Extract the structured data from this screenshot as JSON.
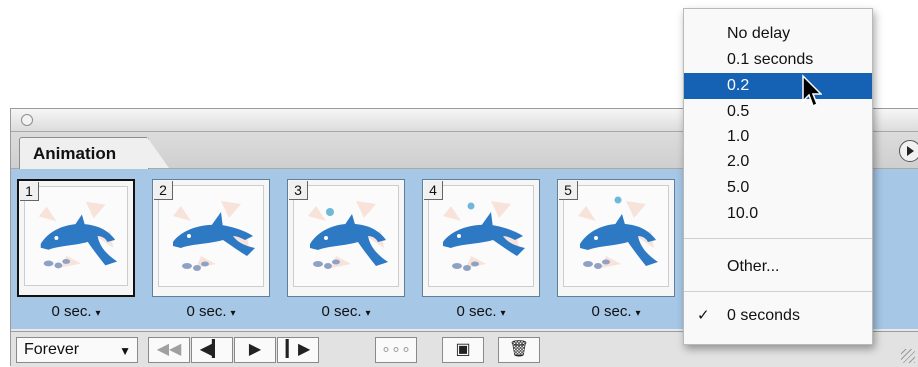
{
  "panel": {
    "tab_label": "Animation",
    "frames": [
      {
        "number": "1",
        "delay": "0 sec.",
        "selected": true
      },
      {
        "number": "2",
        "delay": "0 sec.",
        "selected": false
      },
      {
        "number": "3",
        "delay": "0 sec.",
        "selected": false
      },
      {
        "number": "4",
        "delay": "0 sec.",
        "selected": false
      },
      {
        "number": "5",
        "delay": "0 sec.",
        "selected": false
      }
    ],
    "delay_arrow": "▾",
    "loop_label": "Forever",
    "loop_arrow": "▼"
  },
  "toolbar": {
    "first_frame": "◀◀",
    "prev_frame": "◀▎",
    "play": "▶",
    "next_frame": "▎▶",
    "tween": "∘∘∘",
    "new_frame": "▣",
    "delete": "🗑"
  },
  "delay_menu": {
    "items": [
      "No delay",
      "0.1 seconds",
      "0.2",
      "0.5",
      "1.0",
      "2.0",
      "5.0",
      "10.0"
    ],
    "highlighted": "0.2",
    "other": "Other...",
    "current_check": "✓",
    "current_value": "0 seconds"
  },
  "colors": {
    "frame_strip": "#a6c8e6",
    "menu_highlight": "#1561b4",
    "dolphin": "#2d79c4"
  },
  "icons": {
    "close": "close-icon",
    "panel_menu": "panel-menu-icon",
    "cursor": "pointer-cursor-icon",
    "checkmark": "checkmark-icon"
  }
}
